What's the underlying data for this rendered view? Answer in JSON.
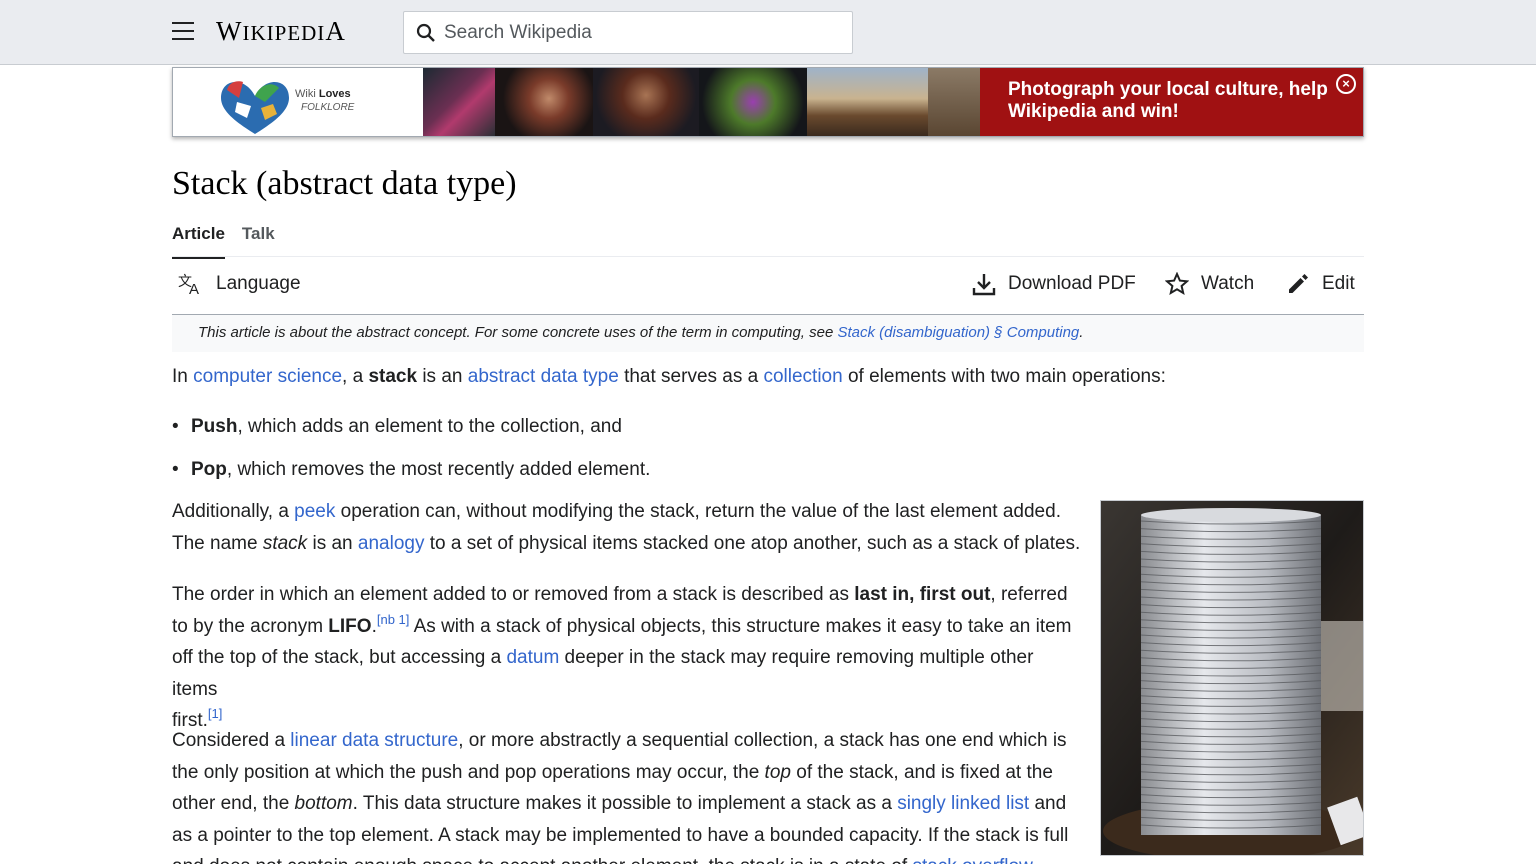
{
  "header": {
    "logo_first": "W",
    "logo_rest": "IKIPEDI",
    "logo_last": "A",
    "search_placeholder": "Search Wikipedia"
  },
  "banner": {
    "wlf_line1": "Wiki",
    "wlf_line1_bold": "Loves",
    "wlf_line2": "FOLKLORE",
    "cta_line1": "Photograph your local culture, help",
    "cta_line2": "Wikipedia and win!",
    "close_glyph": "×",
    "cta_color": "#a01112"
  },
  "page": {
    "title": "Stack (abstract data type)",
    "tabs": [
      {
        "label": "Article",
        "active": true
      },
      {
        "label": "Talk",
        "active": false
      }
    ]
  },
  "toolbar": {
    "language": "Language",
    "download_pdf": "Download PDF",
    "watch": "Watch",
    "edit": "Edit"
  },
  "hatnote": {
    "text": "This article is about the abstract concept. For some concrete uses of the term in computing, see ",
    "link": "Stack (disambiguation) § Computing",
    "end": "."
  },
  "intro": {
    "t1": "In ",
    "l1": "computer science",
    "t2": ", a ",
    "b1": "stack",
    "t3": " is an ",
    "l2": "abstract data type",
    "t4": " that serves as a ",
    "l3": "collection",
    "t5": " of elements with two main operations:"
  },
  "operations": [
    {
      "name": "Push",
      "desc": ", which adds an element to the collection, and"
    },
    {
      "name": "Pop",
      "desc": ", which removes the most recently added element."
    }
  ],
  "para2": {
    "t1": "Additionally, a ",
    "l1": "peek",
    "t2": " operation can, without modifying the stack, return the value of the last element added.",
    "t3": "The name ",
    "i1": "stack",
    "t4": " is an ",
    "l2": "analogy",
    "t5": " to a set of physical items stacked one atop another, such as a stack of plates."
  },
  "para3": {
    "t1": "The order in which an element added to or removed from a stack is described as ",
    "b1": "last in, first out",
    "t2": ", referred",
    "t3": "to by the acronym ",
    "b2": "LIFO",
    "t4": ".",
    "sup1": "[nb 1]",
    "t5": " As with a stack of physical objects, this structure makes it easy to take an item",
    "t6": "off the top of the stack, but accessing a ",
    "l1": "datum",
    "t7": " deeper in the stack may require removing multiple other items",
    "t8": "first.",
    "sup2": "[1]"
  },
  "para4": {
    "t1": "Considered a ",
    "l1": "linear data structure",
    "t2": ", or more abstractly a sequential collection, a stack has one end which is",
    "t3": "the only position at which the push and pop operations may occur, the ",
    "i1": "top",
    "t4": " of the stack, and is fixed at the",
    "t5": "other end, the ",
    "i2": "bottom",
    "t6": ". This data structure makes it possible to implement a stack as a ",
    "l2": "singly linked list",
    "t7": " and",
    "t8": "as a pointer to the top element. A stack may be implemented to have a bounded capacity. If the stack is full",
    "t9": "and does not contain enough space to accept another element, the stack is in a state of ",
    "l3": "stack overflow",
    "t10": "."
  }
}
